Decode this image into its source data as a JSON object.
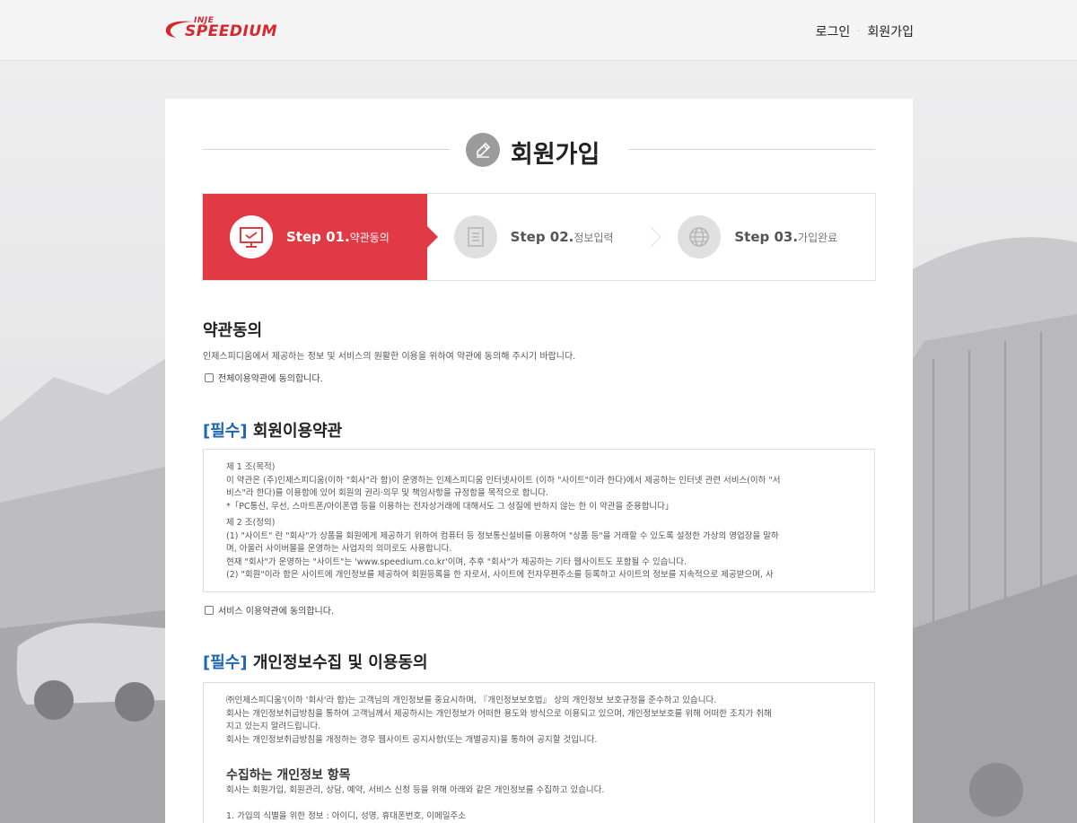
{
  "header": {
    "logo_small": "INJE",
    "logo_main": "SPEEDIUM",
    "nav": {
      "login": "로그인",
      "separator": "·",
      "signup": "회원가입"
    }
  },
  "page": {
    "title": "회원가입"
  },
  "steps": [
    {
      "num": "Step 01.",
      "label": "약관동의",
      "icon": "monitor-icon",
      "active": true
    },
    {
      "num": "Step 02.",
      "label": "정보입력",
      "icon": "document-icon",
      "active": false
    },
    {
      "num": "Step 03.",
      "label": "가입완료",
      "icon": "globe-icon",
      "active": false
    }
  ],
  "agreement": {
    "title": "약관동의",
    "description": "인제스피디움에서 제공하는 정보 및 서비스의 원활한 이용을 위하여 약관에 동의해 주시기 바랍니다.",
    "agree_all": "전체이용약관에 동의합니다."
  },
  "terms": {
    "tag": "[필수]",
    "title": "회원이용약관",
    "lines": [
      "제 1 조(목적)",
      "이 약관은 (주)인제스피디움(이하 \"회사\"라 함)이 운영하는 인제스피디움 인터넷사이트 (이하 \"사이트\"이라 한다)에서 제공하는 인터넷 관련 서비스(이하 \"서",
      "비스\"라 한다)를 이용함에 있어 회원의 권리·의무 및 책임사항을 규정함을 목적으로 합니다.",
      "*「PC통신, 무선, 스마트폰/아이폰앱 등을 이용하는 전자상거래에 대해서도 그 성질에 반하지 않는 한 이 약관을 준용합니다」",
      "제 2 조(정의)",
      "(1) \"사이트\" 란 \"회사\"가 상품을 회원에게 제공하기 위하여 컴퓨터 등 정보통신설비를 이용하여 \"상품 등\"을 거래할 수 있도록 설정한 가상의 영업장을 말하",
      "며, 아울러 사이버몰을 운영하는 사업자의 의미로도 사용합니다.",
      "현재 \"회사\"가 운영하는 \"사이트\"는 'www.speedium.co.kr'이며, 추후 \"회사\"가 제공하는 기타 웹사이트도 포함될 수 있습니다.",
      "(2) \"회원\"이라 함은 사이트에 개인정보를 제공하여 회원등록을 한 자로서, 사이트에 전자우편주소를 등록하고 사이트의 정보를 지속적으로 제공받으며, 사"
    ],
    "agree": "서비스 이용약관에 동의합니다."
  },
  "privacy": {
    "tag": "[필수]",
    "title": "개인정보수집 및 이용동의",
    "lines": [
      "㈜인제스피디움'(이하 '회사'라 함)는 고객님의 개인정보를 중요시하며, 『개인정보보호법』 상의 개인정보 보호규정을 준수하고 있습니다.",
      "회사는 개인정보취급방침을 통하여 고객님께서 제공하시는 개인정보가 어떠한 용도와 방식으로 이용되고 있으며, 개인정보보호를 위해 어떠한 조치가 취해",
      "지고 있는지 알려드립니다.",
      "회사는 개인정보취급방침을 개정하는 경우 웹사이트 공지사항(또는 개별공지)을 통하여 공지할 것입니다."
    ],
    "sub_heading": "수집하는 개인정보 항목",
    "sub_line": "회사는 회원가입, 회원관리, 상담, 예약, 서비스 신청 등을 위해 아래와 같은 개인정보를 수집하고 있습니다.",
    "cut_line": "1. 가입의 식별을 위한 정보 : 아이디, 성명, 휴대폰번호, 이메일주소"
  }
}
